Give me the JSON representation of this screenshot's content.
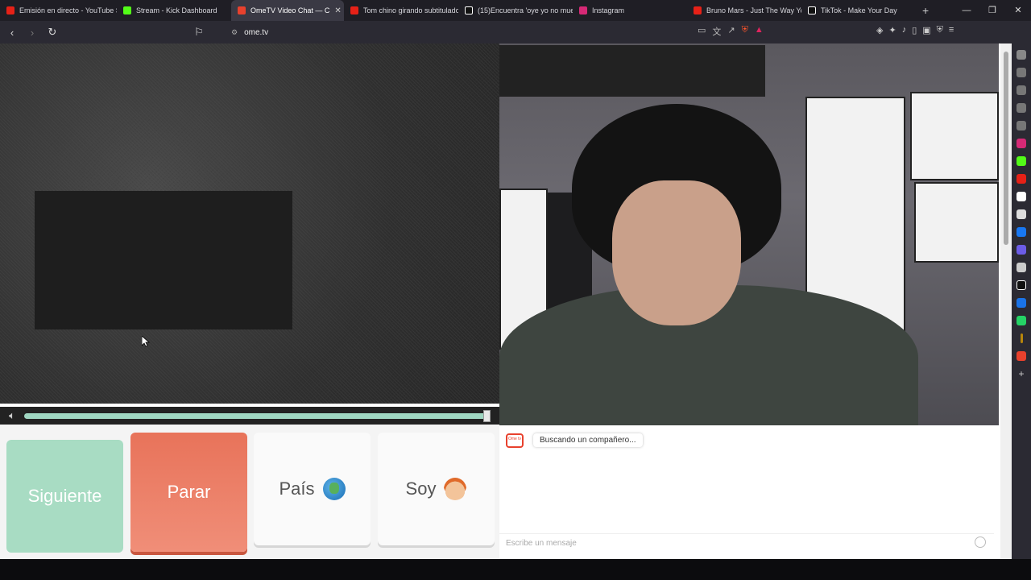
{
  "browser": {
    "tabs": [
      {
        "label": "Emisión en directo - YouTube S",
        "color": "#e62117",
        "active": false
      },
      {
        "label": "Stream - Kick Dashboard",
        "color": "#53fc18",
        "active": false
      },
      {
        "label": "OmeTV Video Chat — C",
        "color": "#e8412d",
        "active": true
      },
      {
        "label": "Tom chino girando subtitulado",
        "color": "#e62117",
        "active": false
      },
      {
        "label": "(15)Encuentra 'oye yo no mue",
        "color": "#ffffff",
        "active": false
      },
      {
        "label": "Instagram",
        "color": "#d62976",
        "active": false
      },
      {
        "label": "Bruno Mars - Just The Way You",
        "color": "#e62117",
        "active": false
      },
      {
        "label": "TikTok - Make Your Day",
        "color": "#ffffff",
        "active": false
      }
    ],
    "tab_close": "✕",
    "new_tab": "+",
    "window_controls": [
      "—",
      "❐",
      "✕"
    ],
    "url": "ome.tv",
    "nav": {
      "back": "‹",
      "forward": "›",
      "reload": "↻",
      "bookmark": "⚐"
    }
  },
  "page": {
    "volume_level": 1.0,
    "buttons": {
      "next": "Siguiente",
      "stop": "Parar",
      "country": "País",
      "me": "Soy"
    },
    "chat": {
      "logo_text": "Ome tv",
      "status_message": "Buscando un compañero...",
      "input_placeholder": "Escribe un mensaje"
    }
  },
  "colors": {
    "next_button": "#a8dcc3",
    "stop_button": "#e8735a",
    "accent": "#e8412d"
  }
}
